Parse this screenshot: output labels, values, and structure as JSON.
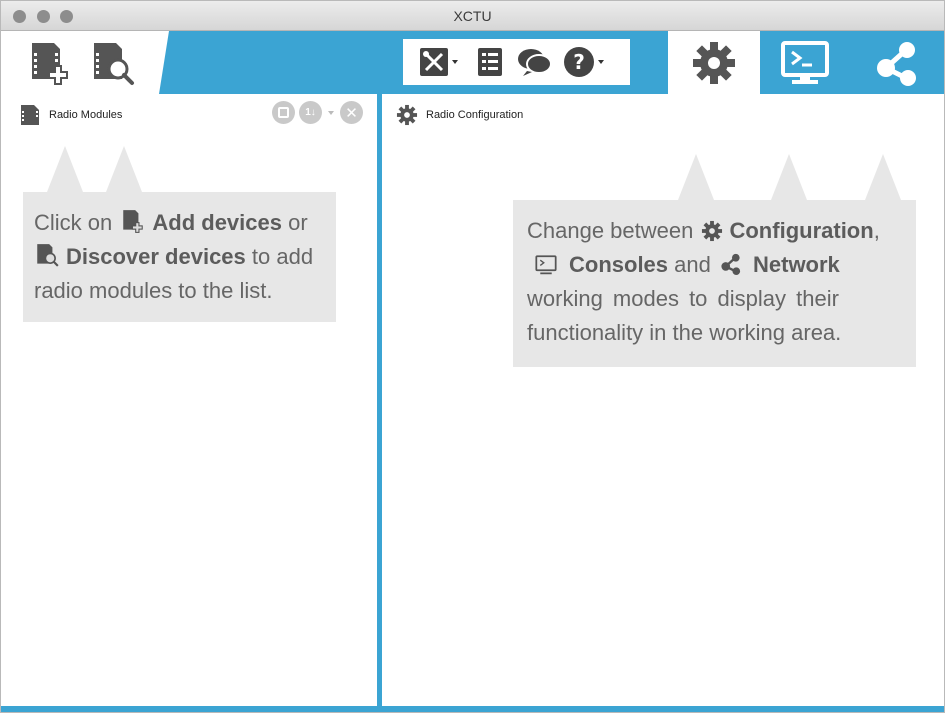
{
  "window": {
    "title": "XCTU"
  },
  "left_panel": {
    "title": "Radio Modules"
  },
  "right_panel": {
    "title": "Radio Configuration"
  },
  "left_callout": {
    "prefix": "Click on",
    "add_label": "Add devices",
    "or_text": "or",
    "discover_label": "Discover devices",
    "suffix_1": "to add",
    "line_3": "radio modules to the list."
  },
  "right_callout": {
    "prefix": "Change between",
    "configuration_label": "Configuration",
    "comma": ",",
    "consoles_label": "Consoles",
    "and_text": "and",
    "network_label": "Network",
    "line_3": "working modes to display their",
    "line_4": "functionality in the working area."
  },
  "colors": {
    "accent": "#3ba4d3",
    "callout_bg": "#e7e7e7",
    "icon_dark": "#555555"
  },
  "icons": [
    "add-device-icon",
    "discover-device-icon",
    "tools-icon",
    "log-icon",
    "feedback-icon",
    "help-icon",
    "configuration-gear-icon",
    "consoles-icon",
    "network-icon"
  ]
}
